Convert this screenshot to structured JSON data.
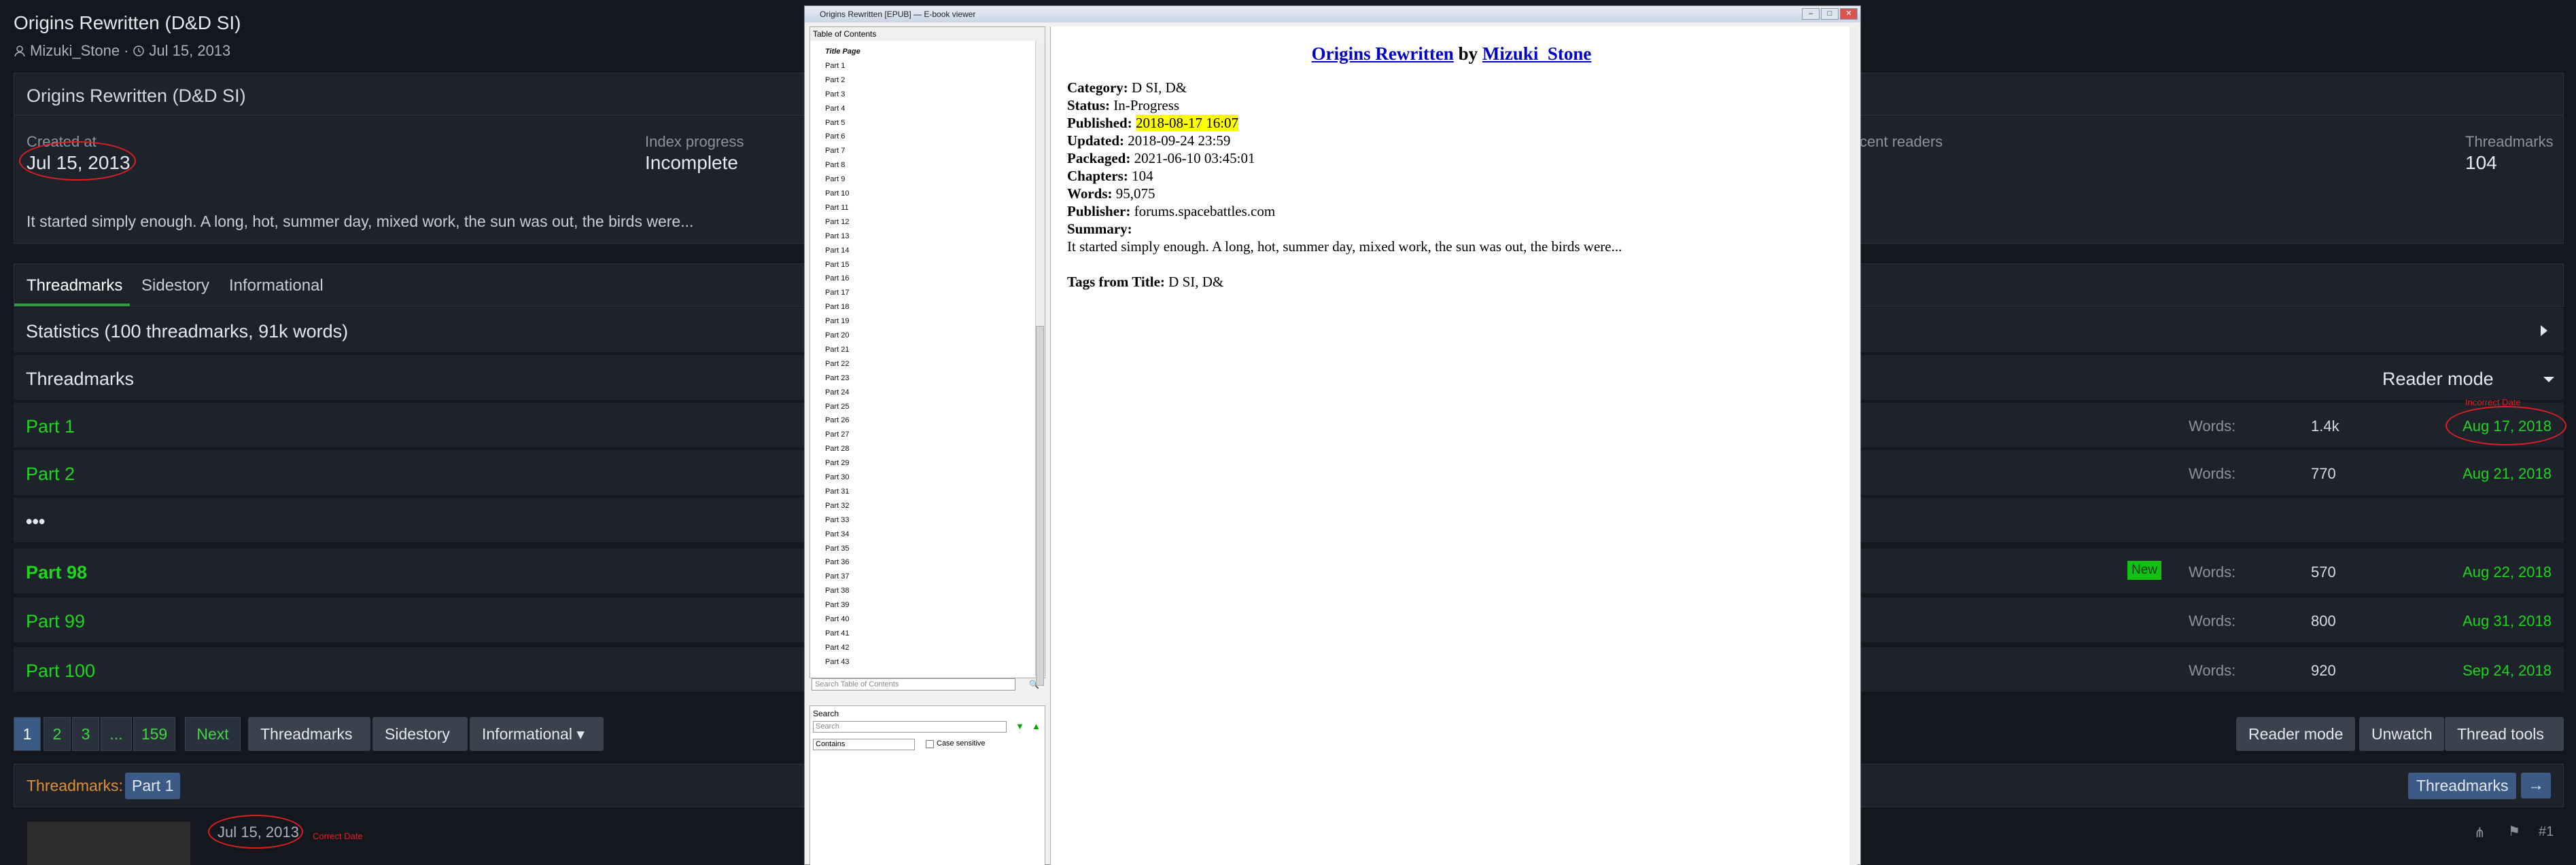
{
  "thread": {
    "title": "Origins Rewritten (D&D SI)",
    "author": "Mizuki_Stone",
    "date": "Jul 15, 2013"
  },
  "info_panel": {
    "heading": "Origins Rewritten (D&D SI)",
    "created_label": "Created at",
    "created_value": "Jul 15, 2013",
    "index_label": "Index progress",
    "index_value": "Incomplete",
    "readers_label": "cent readers",
    "threadmarks_label": "Threadmarks",
    "threadmarks_value": "104",
    "summary": "It started simply enough. A long, hot, summer day, mixed work, the sun was out, the birds were..."
  },
  "tabs": [
    "Threadmarks",
    "Sidestory",
    "Informational"
  ],
  "statistics": "Statistics (100 threadmarks, 91k words)",
  "threadmarks_header": {
    "title": "Threadmarks",
    "reader_mode": "Reader mode"
  },
  "rows": [
    {
      "title": "Part 1",
      "words_label": "Words:",
      "words": "1.4k",
      "date": "Aug 17, 2018"
    },
    {
      "title": "Part 2",
      "words_label": "Words:",
      "words": "770",
      "date": "Aug 21, 2018"
    },
    {
      "title": "•••"
    },
    {
      "title": "Part 98",
      "badge": "New",
      "words_label": "Words:",
      "words": "570",
      "date": "Aug 22, 2018"
    },
    {
      "title": "Part 99",
      "words_label": "Words:",
      "words": "800",
      "date": "Aug 31, 2018"
    },
    {
      "title": "Part 100",
      "words_label": "Words:",
      "words": "920",
      "date": "Sep 24, 2018"
    }
  ],
  "pagination": [
    "1",
    "2",
    "3",
    "...",
    "159",
    "Next"
  ],
  "nav_buttons": [
    "Threadmarks",
    "Sidestory",
    "Informational"
  ],
  "right_buttons": [
    "Reader mode",
    "Unwatch",
    "Thread tools"
  ],
  "threadmark_bar": {
    "label": "Threadmarks:",
    "part": "Part 1",
    "button": "Threadmarks"
  },
  "post": {
    "date": "Jul 15, 2013",
    "number": "#1"
  },
  "annotations": {
    "incorrect": "Incorrect Date",
    "correct": "Correct Date"
  },
  "ebook": {
    "window_title": "Origins Rewritten [EPUB] — E-book viewer",
    "toc_heading": "Table of Contents",
    "toc_first": "Title Page",
    "toc_search_placeholder": "Search Table of Contents",
    "search_heading": "Search",
    "search_placeholder": "Search",
    "contains": "Contains",
    "case_sensitive": "Case sensitive",
    "book_title": "Origins Rewritten",
    "by": "by",
    "book_author": "Mizuki_Stone",
    "category_label": "Category:",
    "category": "D SI, D&",
    "status_label": "Status:",
    "status": "In-Progress",
    "published_label": "Published:",
    "published": "2018-08-17 16:07",
    "updated_label": "Updated:",
    "updated": "2018-09-24 23:59",
    "packaged_label": "Packaged:",
    "packaged": "2021-06-10 03:45:01",
    "chapters_label": "Chapters:",
    "chapters": "104",
    "words_label": "Words:",
    "words": "95,075",
    "publisher_label": "Publisher:",
    "publisher": "forums.spacebattles.com",
    "summary_label": "Summary:",
    "summary": "It started simply enough. A long, hot, summer day, mixed work, the sun was out, the birds were...",
    "tags_label": "Tags from Title:",
    "tags": "D SI, D&"
  }
}
